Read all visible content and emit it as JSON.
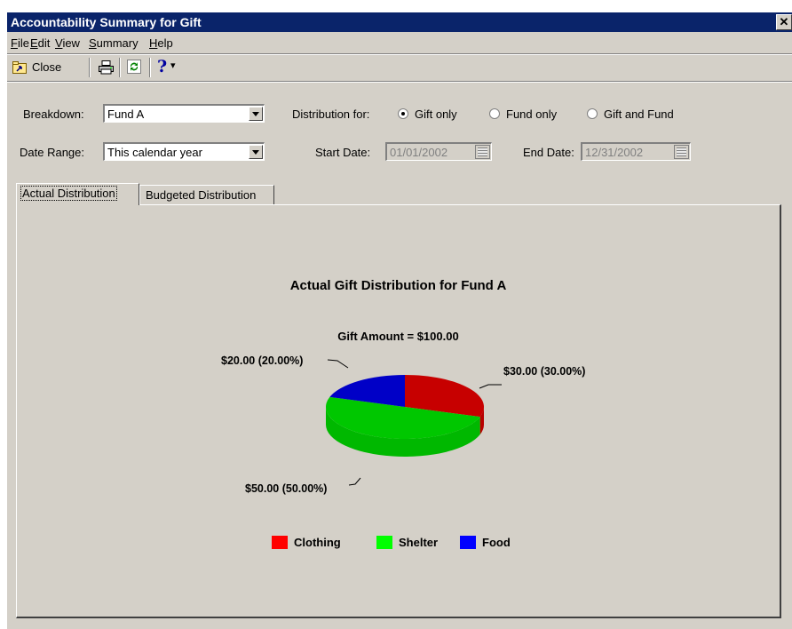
{
  "window": {
    "title": "Accountability Summary for Gift",
    "close_glyph": "✕"
  },
  "menu": [
    {
      "accel": "F",
      "rest": "ile"
    },
    {
      "accel": "E",
      "rest": "dit"
    },
    {
      "accel": "V",
      "rest": "iew"
    },
    {
      "accel": "S",
      "rest": "ummary"
    },
    {
      "accel": "H",
      "rest": "elp"
    }
  ],
  "toolbar": {
    "close_label": "Close",
    "icons": [
      "close-folder-icon",
      "print-icon",
      "refresh-icon",
      "help-icon"
    ],
    "help_glyph": "?",
    "help_dropdown_glyph": "▾"
  },
  "form": {
    "breakdown_label": "Breakdown:",
    "breakdown_value": "Fund A",
    "distribution_label": "Distribution for:",
    "distribution_options": [
      {
        "label": "Gift only",
        "selected": true
      },
      {
        "label": "Fund only",
        "selected": false
      },
      {
        "label": "Gift and Fund",
        "selected": false
      }
    ],
    "date_range_label": "Date Range:",
    "date_range_value": "This calendar year",
    "start_date_label": "Start Date:",
    "start_date_value": "01/01/2002",
    "end_date_label": "End Date:",
    "end_date_value": "12/31/2002"
  },
  "tabs": [
    {
      "label": "Actual Distribution",
      "active": true
    },
    {
      "label": "Budgeted Distribution",
      "active": false
    }
  ],
  "chart_data": {
    "type": "pie",
    "title": "Actual Gift Distribution for Fund A",
    "subtitle": "Gift Amount = $100.00",
    "categories": [
      "Clothing",
      "Shelter",
      "Food"
    ],
    "values": [
      30,
      50,
      20
    ],
    "data_labels": [
      "$30.00 (30.00%)",
      "$50.00 (50.00%)",
      "$20.00 (20.00%)"
    ],
    "colors": [
      "#ff0000",
      "#00ff00",
      "#0000ff"
    ],
    "legend_position": "bottom",
    "three_d": true
  }
}
